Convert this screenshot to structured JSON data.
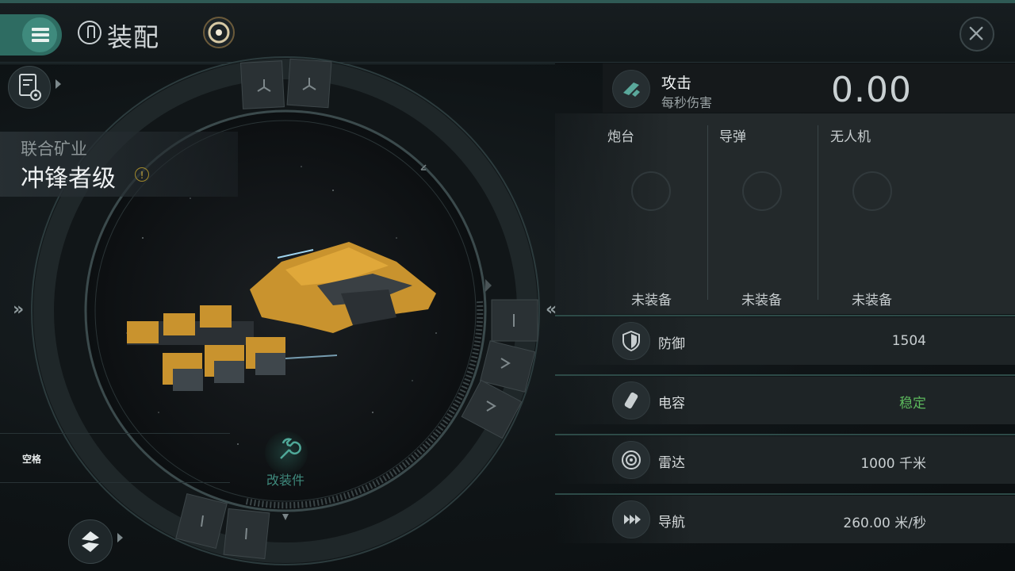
{
  "header": {
    "title": "装配",
    "menu_icon": "hamburger-menu-icon",
    "close_icon": "close-icon"
  },
  "ship": {
    "corporation": "联合矿业",
    "name": "冲锋者级",
    "warning_symbol": "!"
  },
  "left": {
    "empty_slot_label": "空格",
    "modify_label": "改装件",
    "nav_left": "»",
    "nav_right": "«"
  },
  "attack": {
    "title": "攻击",
    "subtitle": "每秒伤害",
    "dps": "0.00"
  },
  "weapons": [
    {
      "label": "炮台",
      "status": "未装备",
      "icon": "turret-icon"
    },
    {
      "label": "导弹",
      "status": "未装备",
      "icon": "missile-icon"
    },
    {
      "label": "无人机",
      "status": "未装备",
      "icon": "drone-icon"
    }
  ],
  "stats": [
    {
      "label": "防御",
      "value": "1504",
      "icon": "shield-icon",
      "color": "#c9cfd1"
    },
    {
      "label": "电容",
      "value": "稳定",
      "icon": "capacitor-icon",
      "color": "#5cb85c"
    },
    {
      "label": "雷达",
      "value": "1000 千米",
      "icon": "radar-icon",
      "color": "#c9cfd1"
    },
    {
      "label": "导航",
      "value": "260.00 米/秒",
      "icon": "navigation-icon",
      "color": "#c9cfd1"
    }
  ],
  "colors": {
    "accent": "#3f8a7d",
    "stable_green": "#5cb85c"
  }
}
